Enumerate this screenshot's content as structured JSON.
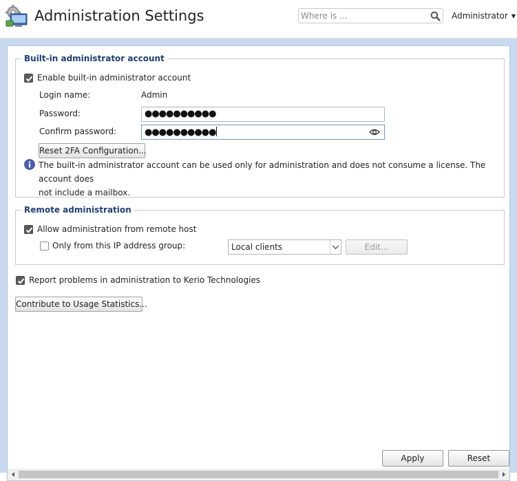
{
  "header": {
    "title": "Administration Settings",
    "search_placeholder": "Where is ...",
    "user_menu": "Administrator"
  },
  "builtin": {
    "legend": "Built-in administrator account",
    "enable_label": "Enable built-in administrator account",
    "enable_checked": true,
    "login_label": "Login name:",
    "login_value": "Admin",
    "password_label": "Password:",
    "password_value": "●●●●●●●●●●",
    "confirm_label": "Confirm password:",
    "confirm_value": "●●●●●●●●●●",
    "reset_2fa_button": "Reset 2FA Configuration...",
    "info_line1": "The built-in administrator account can be used only for administration and does not consume a license. The account does",
    "info_line2": "not include a mailbox."
  },
  "remote": {
    "legend": "Remote administration",
    "allow_label": "Allow administration from remote host",
    "allow_checked": true,
    "ip_group_label": "Only from this IP address group:",
    "ip_group_checked": false,
    "ip_group_value": "Local clients",
    "edit_button": "Edit..."
  },
  "report": {
    "label": "Report problems in administration to Kerio Technologies",
    "checked": true
  },
  "usage_button": "Contribute to Usage Statistics...",
  "footer": {
    "apply": "Apply",
    "reset": "Reset"
  },
  "colors": {
    "frame": "#c9d9ef",
    "legend_text": "#1f3e72",
    "info_icon": "#4b5fb5"
  },
  "icons": {
    "app": "admin-settings-icon",
    "search": "search-icon",
    "info": "info-icon",
    "eye": "eye-icon"
  }
}
